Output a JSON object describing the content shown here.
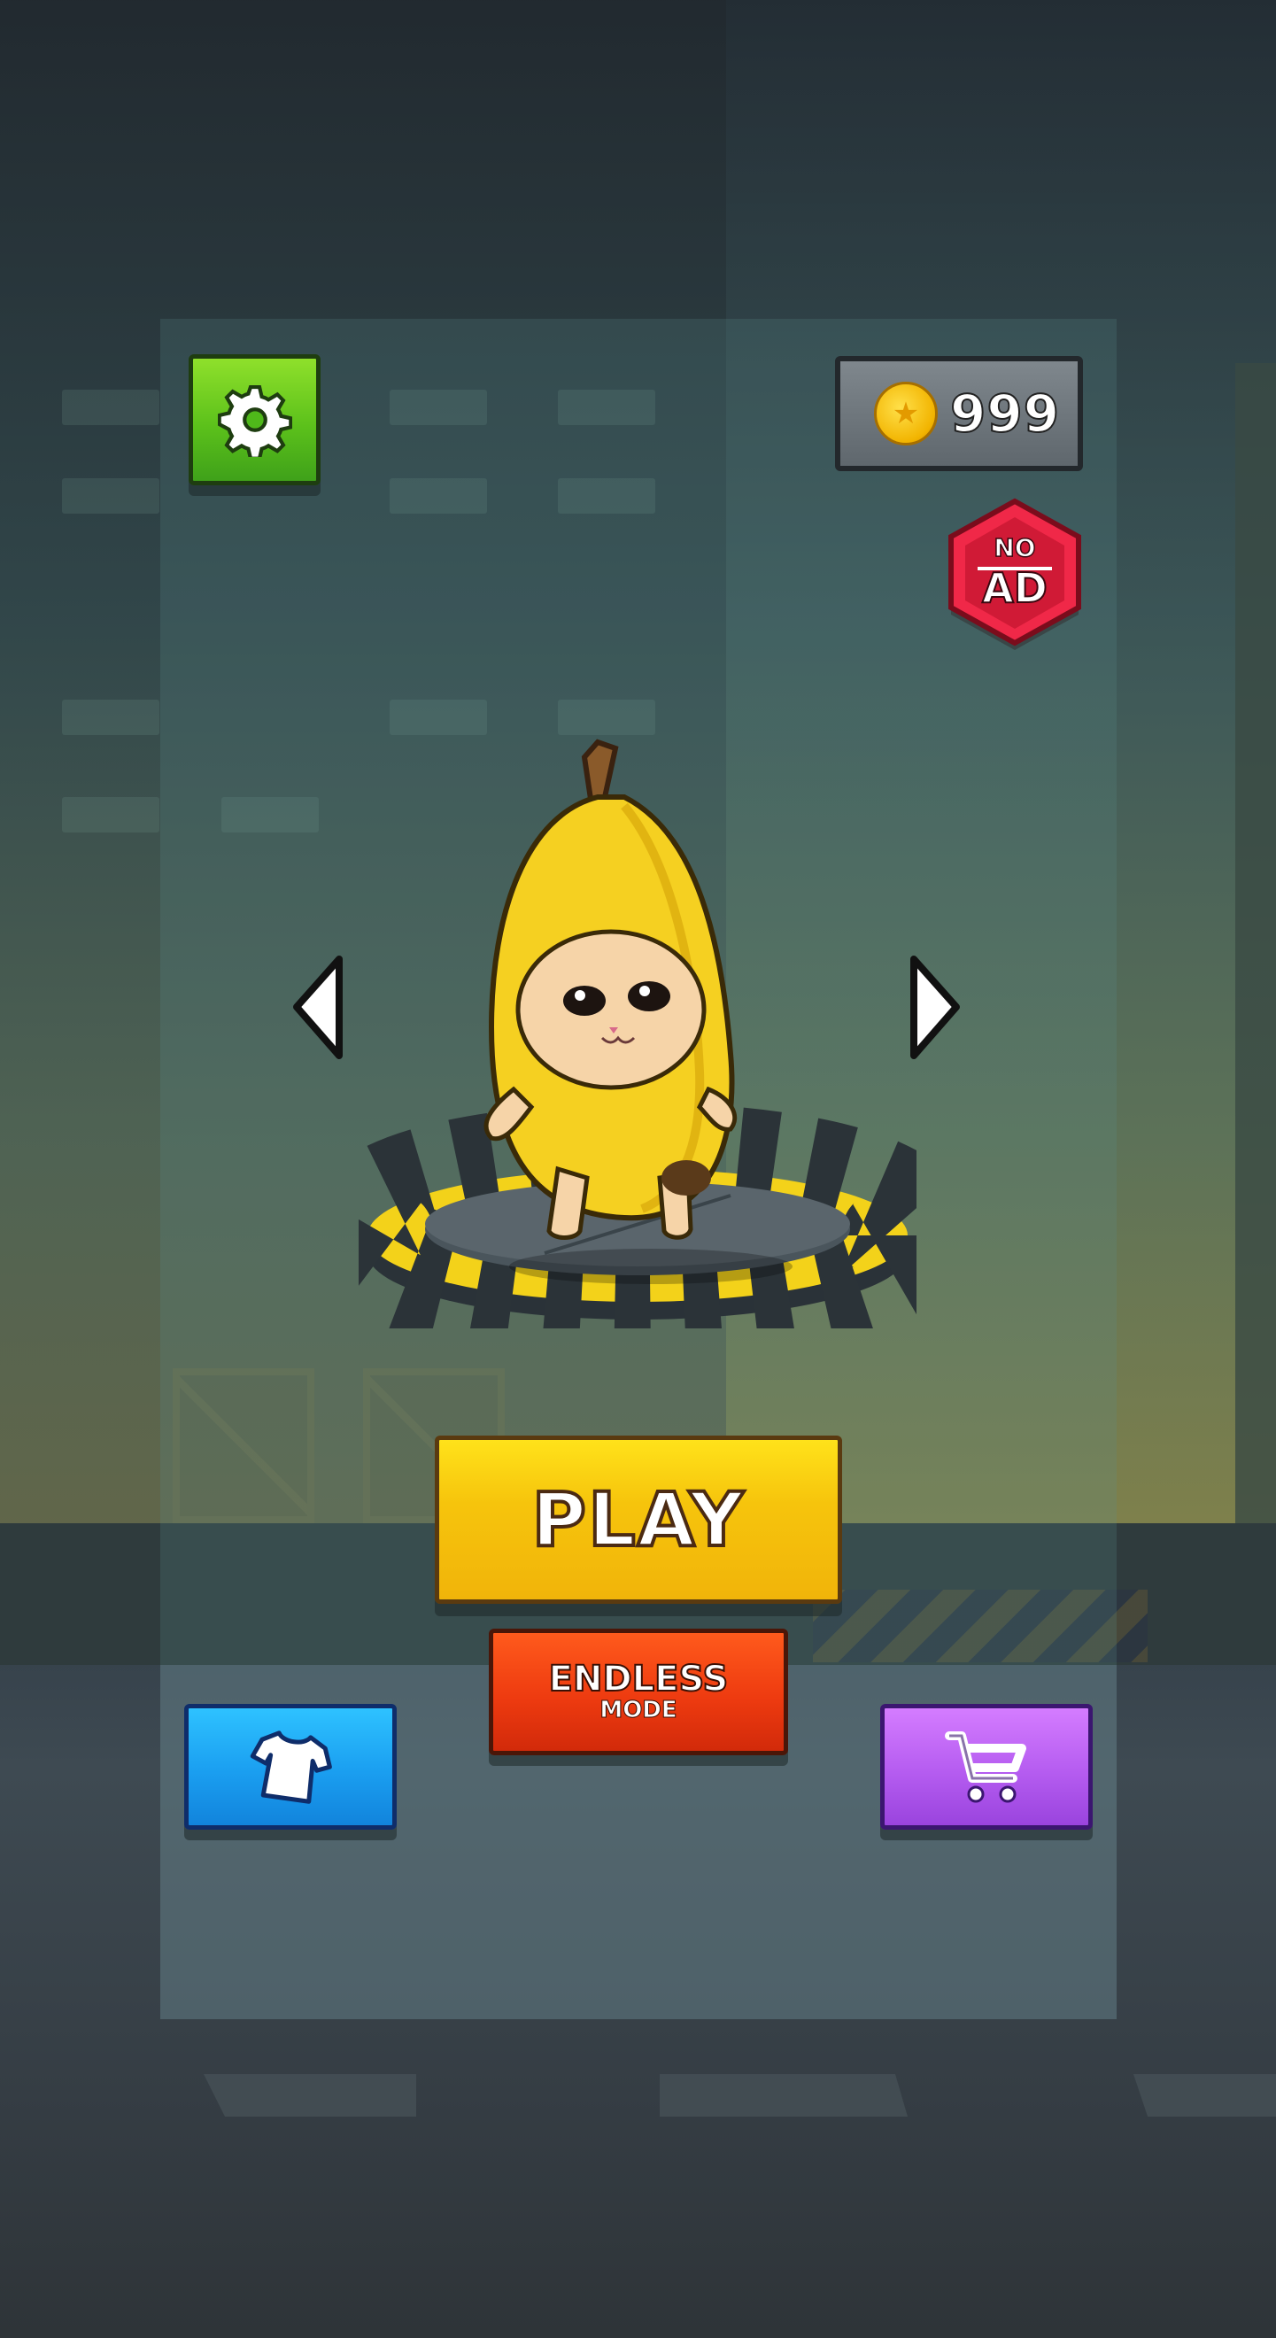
{
  "header": {
    "settings_icon": "gear-icon",
    "coins": {
      "icon": "coin-icon",
      "amount": "999"
    },
    "no_ad": {
      "line1": "NO",
      "line2": "AD"
    }
  },
  "character_select": {
    "prev_icon": "chevron-left-icon",
    "next_icon": "chevron-right-icon",
    "character": "banana-cat"
  },
  "actions": {
    "play_label": "PLAY",
    "endless_label": "ENDLESS",
    "endless_sub": "MODE",
    "skins_icon": "tshirt-icon",
    "shop_icon": "cart-icon"
  },
  "colors": {
    "settings": "#5cc11b",
    "play": "#f6c40c",
    "endless": "#ee3b10",
    "skins": "#1a9ef0",
    "shop": "#b55cf0",
    "no_ad": "#e0203a",
    "coin": "#f2b400"
  }
}
